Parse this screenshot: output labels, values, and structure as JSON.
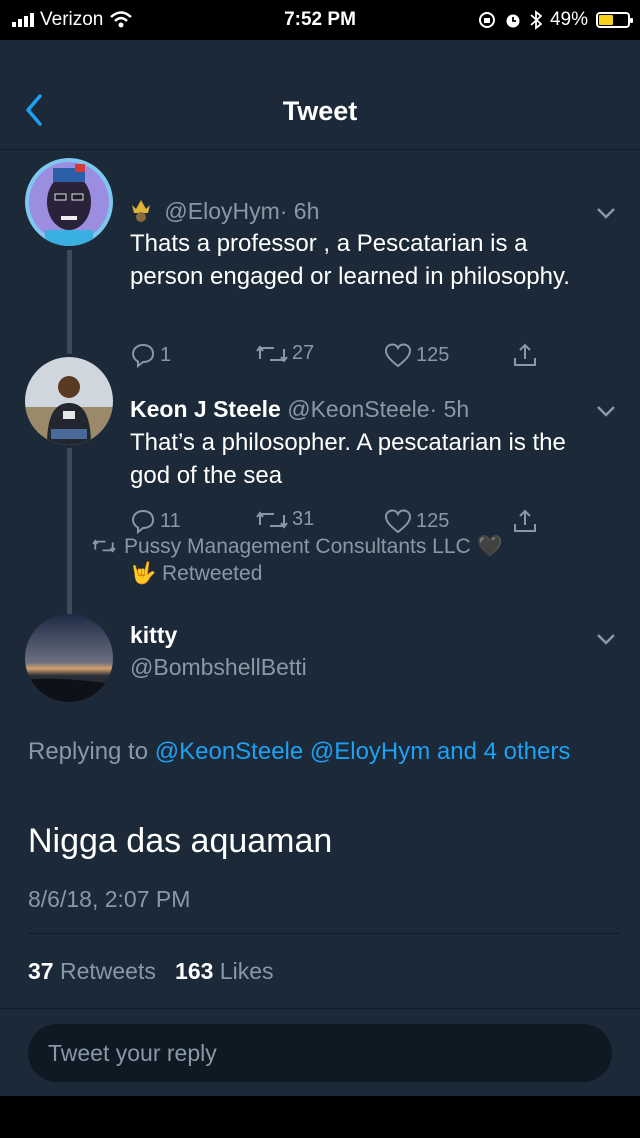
{
  "status_bar": {
    "carrier": "Verizon",
    "time": "7:52 PM",
    "battery": "49%",
    "battery_level": 0.49,
    "icons": [
      "signal-icon",
      "wifi-icon",
      "orientation-lock-icon",
      "alarm-icon",
      "bluetooth-icon",
      "battery-icon"
    ]
  },
  "nav": {
    "title": "Tweet",
    "back_icon": "chevron-left-icon"
  },
  "thread": [
    {
      "name": "",
      "handle": "@EloyHym",
      "time": "· 6h",
      "text": "Thats a professor , a Pescatarian is a person engaged or learned in philosophy.",
      "replies": "1",
      "retweets": "27",
      "likes": "125"
    },
    {
      "name": "Keon J Steele",
      "handle": "@KeonSteele",
      "time": "· 5h",
      "text": "That’s a philosopher. A pescatarian is the god of the sea",
      "replies": "11",
      "retweets": "31",
      "likes": "125"
    }
  ],
  "retweet_notice": {
    "line1": "Pussy Management Consultants LLC 🖤",
    "line2": "🤟 Retweeted"
  },
  "main_tweet": {
    "name": "kitty",
    "handle": "@BombshellBetti",
    "replying_prefix": "Replying to",
    "replying_to": "@KeonSteele @EloyHym and 4 others",
    "text": "Nigga das aquaman",
    "date": "8/6/18, 2:07 PM",
    "retweet_count": "37",
    "retweet_label": "Retweets",
    "like_count": "163",
    "like_label": "Likes"
  },
  "reply": {
    "placeholder": "Tweet your reply"
  },
  "colors": {
    "background": "#1c2938",
    "accent": "#1da1f2",
    "secondary_text": "#8899a6"
  }
}
